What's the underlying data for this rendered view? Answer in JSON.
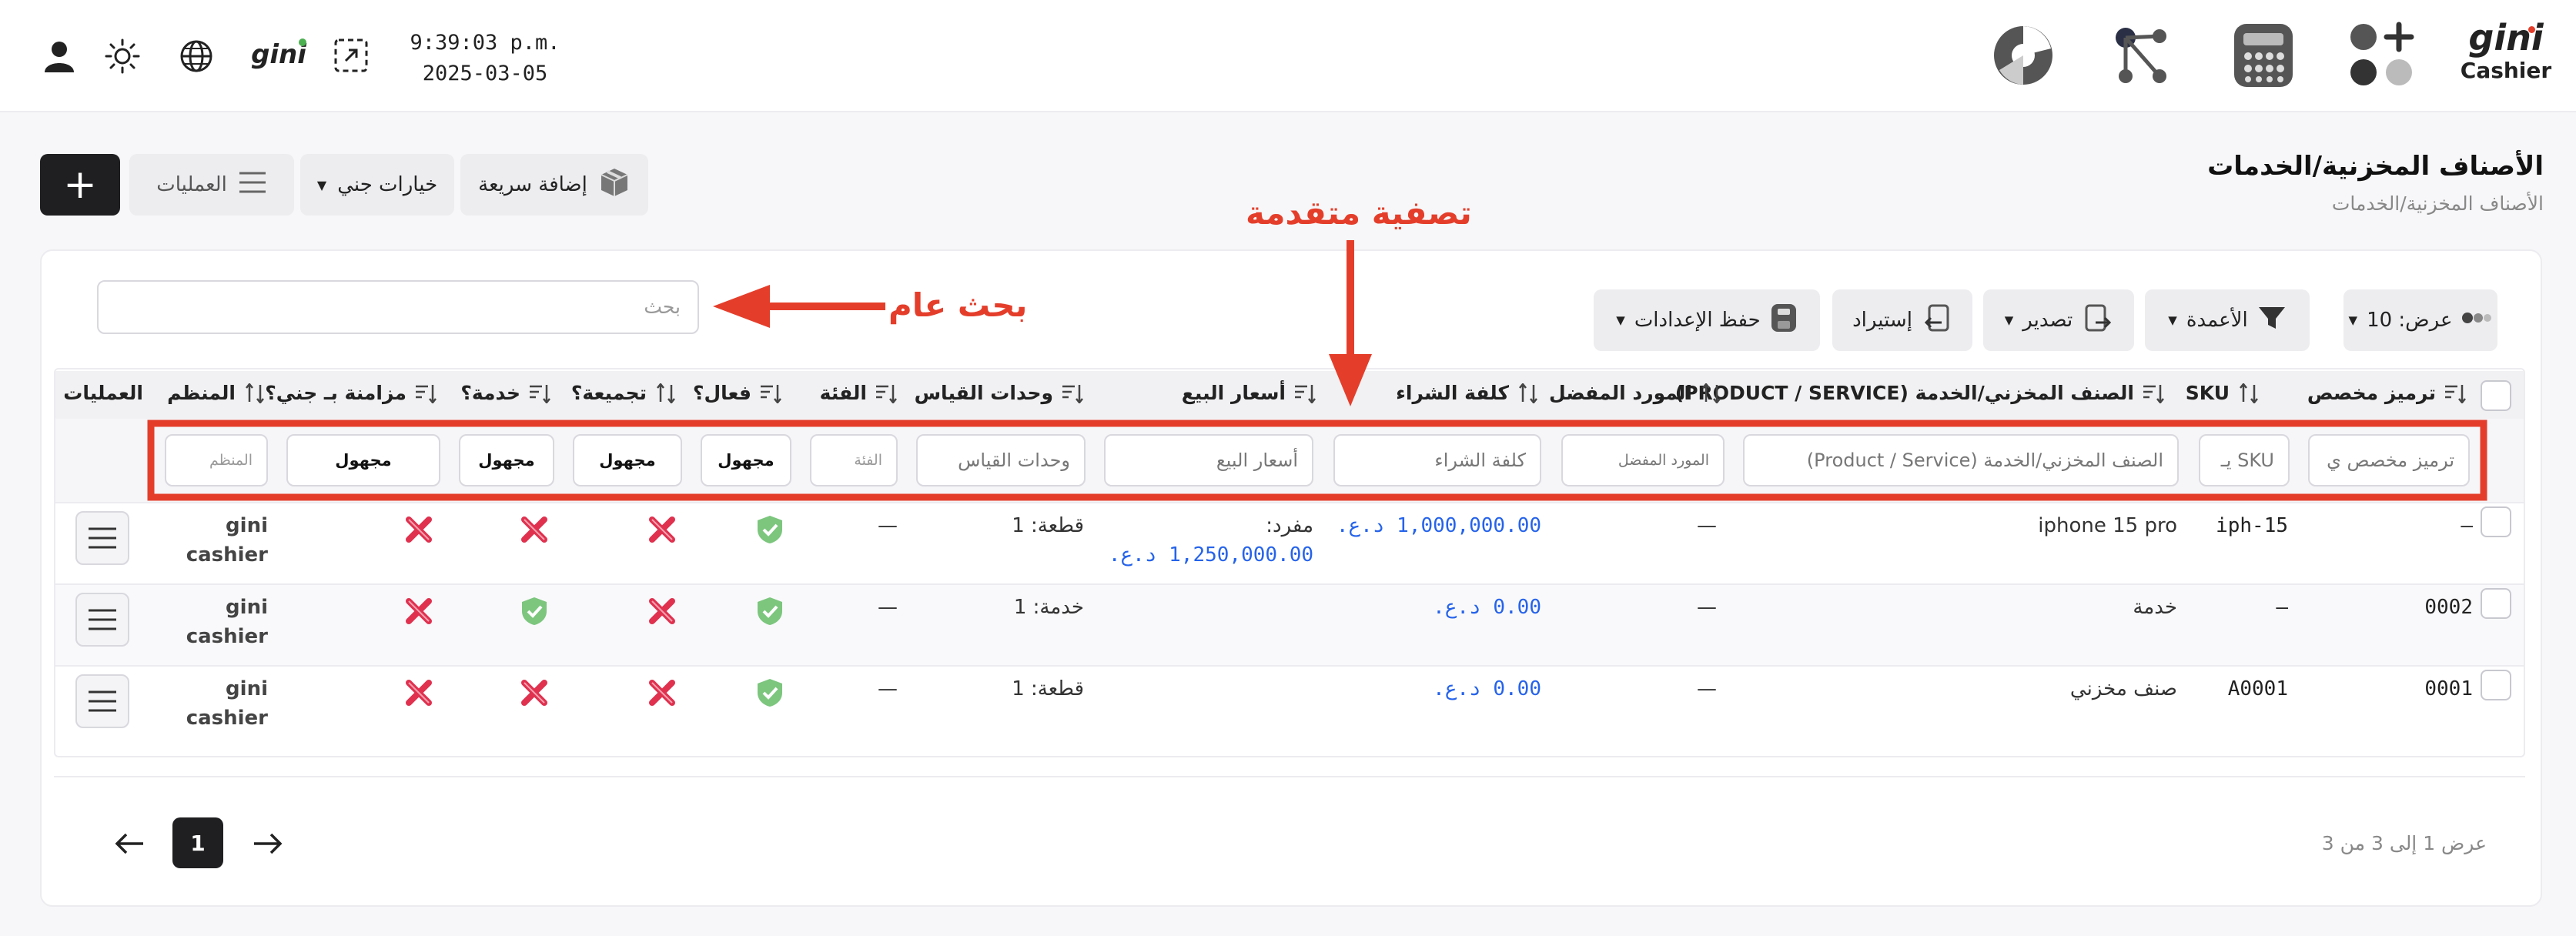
{
  "topbar": {
    "time": "9:39:03 p.m.",
    "date": "2025-03-05",
    "logo_text": "gini",
    "logo_subtext": "Cashier",
    "small_logo_text": "gini",
    "icons": [
      "user-icon",
      "sun-icon",
      "globe-icon",
      "gini-logo",
      "fullscreen-icon",
      "pie-chart-icon",
      "network-icon",
      "calculator-icon",
      "apps-add-icon"
    ]
  },
  "header": {
    "title": "الأصناف المخزنية/الخدمات",
    "breadcrumb": "الأصناف المخزنية/الخدمات",
    "quick_add": "إضافة سريعة",
    "gini_options": "خيارات جني",
    "operations": "العمليات",
    "add": "+"
  },
  "toolbar": {
    "search_placeholder": "بحث",
    "view": "عرض: 10",
    "columns": "الأعمدة",
    "export": "تصدير",
    "import": "إستيراد",
    "save_settings": "حفظ الإعدادات"
  },
  "annotations": {
    "global_search": "بحث عام",
    "advanced_filter": "تصفية متقدمة"
  },
  "table": {
    "headers": {
      "custom_code": "ترميز مخصص",
      "sku": "SKU",
      "item": "الصنف المخزني/الخدمة (PRODUCT / SERVICE)",
      "supplier": "المورد المفضل",
      "cost": "كلفة الشراء",
      "prices": "أسعار البيع",
      "units": "وحدات القياس",
      "category": "الفئة",
      "active": "فعال؟",
      "bundle": "تجميعة؟",
      "service": "خدمة؟",
      "sync": "مزامنة بـ جني؟",
      "organizer": "المنظم",
      "operations": "العمليات"
    },
    "filters": {
      "custom_code": "ترميز مخصص ي",
      "sku": "SKU يـ",
      "item": "الصنف المخزني/الخدمة (Product / Service)",
      "supplier": "المورد المفضل",
      "cost": "كلفة الشراء",
      "prices": "أسعار البيع",
      "units": "وحدات القياس",
      "category": "الفئة",
      "active": "مجهول",
      "bundle": "مجهول",
      "service": "مجهول",
      "sync": "مجهول",
      "organizer": "المنظم"
    },
    "rows": [
      {
        "custom_code": "—",
        "sku": "iph-15",
        "item": "iphone 15 pro",
        "supplier": "—",
        "cost": "1,000,000.00 د.ع.",
        "price_label": "مفرد:",
        "price_value": "1,250,000.00 د.ع.",
        "units": "قطعة: 1",
        "category": "—",
        "active": true,
        "bundle": false,
        "service": false,
        "sync": false,
        "organizer_1": "gini",
        "organizer_2": "cashier"
      },
      {
        "custom_code": "0002",
        "sku": "—",
        "item": "خدمة",
        "supplier": "—",
        "cost": "0.00 د.ع.",
        "price_label": "",
        "price_value": "",
        "units": "خدمة: 1",
        "category": "—",
        "active": true,
        "bundle": false,
        "service": true,
        "sync": false,
        "organizer_1": "gini",
        "organizer_2": "cashier"
      },
      {
        "custom_code": "0001",
        "sku": "A0001",
        "item": "صنف مخزني",
        "supplier": "—",
        "cost": "0.00 د.ع.",
        "price_label": "",
        "price_value": "",
        "units": "قطعة: 1",
        "category": "—",
        "active": true,
        "bundle": false,
        "service": false,
        "sync": false,
        "organizer_1": "gini",
        "organizer_2": "cashier"
      }
    ]
  },
  "pagination": {
    "info": "عرض 1 إلى 3 من 3",
    "current_page": "1"
  },
  "colors": {
    "accent_red": "#e43e2b",
    "blue_value": "#2563eb",
    "green_ok": "#4caf50",
    "red_no": "#e0314f",
    "dark_button": "#1f1f22"
  }
}
